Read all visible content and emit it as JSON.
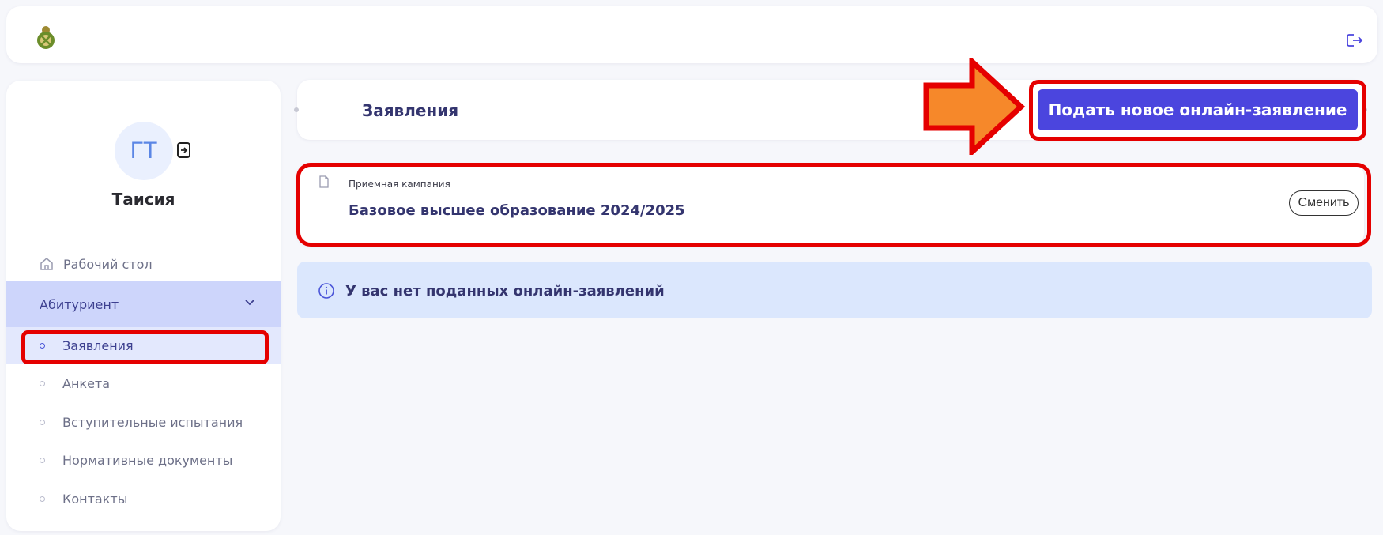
{
  "header": {
    "logo_icon": "emblem-icon",
    "logout_icon": "logout-icon"
  },
  "user": {
    "initials": "ГТ",
    "name": "Таисия"
  },
  "nav": {
    "home": "Рабочий стол",
    "group": "Абитуриент",
    "items": [
      {
        "label": "Заявления",
        "active": true
      },
      {
        "label": "Анкета",
        "active": false
      },
      {
        "label": "Вступительные испытания",
        "active": false
      },
      {
        "label": "Нормативные документы",
        "active": false
      },
      {
        "label": "Контакты",
        "active": false
      }
    ]
  },
  "main": {
    "title": "Заявления",
    "primary_button": "Подать новое онлайн-заявление",
    "campaign": {
      "label": "Приемная кампания",
      "value": "Базовое высшее образование 2024/2025",
      "change_button": "Сменить"
    },
    "info_message": "У вас нет поданных онлайн-заявлений"
  },
  "colors": {
    "primary": "#4b45de",
    "highlight": "#e50000",
    "arrow": "#f6882a",
    "info_bg": "#dbe7fd",
    "nav_active_bg": "#cdd5fb"
  }
}
